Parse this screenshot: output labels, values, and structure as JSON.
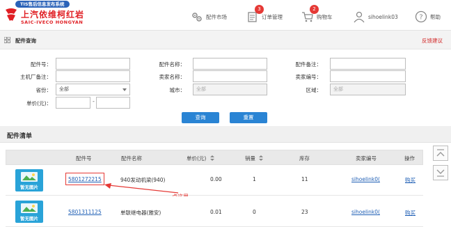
{
  "header": {
    "system_badge": "TIS售后信息发布系统",
    "brand_cn": "上汽依维柯红岩",
    "brand_en": "SAIC-IVECO HONGYAN",
    "nav": {
      "parts_market": "配件市场",
      "orders": "订单管理",
      "orders_count": "3",
      "cart": "购物车",
      "cart_count": "2",
      "user": "sihoelink03",
      "help": "帮助"
    }
  },
  "subbar": {
    "title": "配件查询",
    "feedback": "反馈建议"
  },
  "form": {
    "part_no_label": "配件号：",
    "part_name_label": "配件名称：",
    "part_note_label": "配件备注：",
    "oem_note_label": "主机厂备注：",
    "seller_name_label": "卖家名称：",
    "seller_no_label": "卖家编号：",
    "province_label": "省份：",
    "province_value": "全部",
    "city_label": "城市：",
    "city_value": "全部",
    "region_label": "区域：",
    "region_value": "全部",
    "price_label": "单价(元)：",
    "price_sep": "-",
    "search_button": "查询",
    "reset_button": "重置"
  },
  "list": {
    "title": "配件清单",
    "columns": [
      "配件号",
      "配件名称",
      "单价(元)",
      "销量",
      "库存",
      "卖家编号",
      "操作"
    ],
    "rows": [
      {
        "thumb": "暂无图片",
        "part_no": "5801272215",
        "part_name": "940发动机梁(940)",
        "price": "0.00",
        "sales": "1",
        "stock": "11",
        "seller_no": "sihoelink0(",
        "action": "购买"
      },
      {
        "thumb": "暂无图片",
        "part_no": "5801311125",
        "part_name": "单联继电器(雅安)",
        "price": "0.01",
        "sales": "0",
        "stock": "23",
        "seller_no": "sihoelink0(",
        "action": "购买"
      }
    ],
    "annotation": "点这里"
  },
  "colors": {
    "brand_red": "#e01f24",
    "button_blue": "#2a84d4",
    "link_blue": "#1f5fb5",
    "badge_red": "#e53935",
    "thumb_blue": "#29a3d8"
  }
}
